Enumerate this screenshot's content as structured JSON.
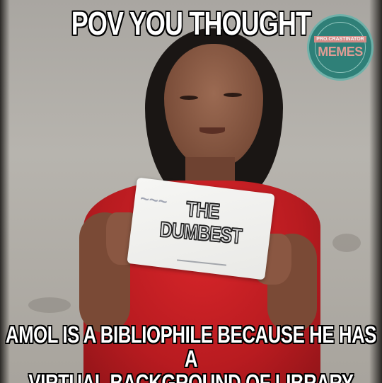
{
  "meme": {
    "top_caption": "POV YOU THOUGHT",
    "bottom_caption_line1": "AMOL IS A BIBLIOPHILE BECAUSE HE HAS A",
    "bottom_caption_line2": "VIRTUAL BACKGROUND OF LIBRARY"
  },
  "sign": {
    "line1": "THE",
    "line2": "DUMBEST"
  },
  "logo": {
    "top_text": "PRO.CRASTINATOR",
    "main_text": "MEMES"
  },
  "colors": {
    "shirt": "#c41f24",
    "wall": "#aeaba5",
    "logo_teal": "#1e7a72",
    "logo_pink": "#e79a92",
    "caption_fill": "#ffffff",
    "caption_outline": "#000000"
  }
}
